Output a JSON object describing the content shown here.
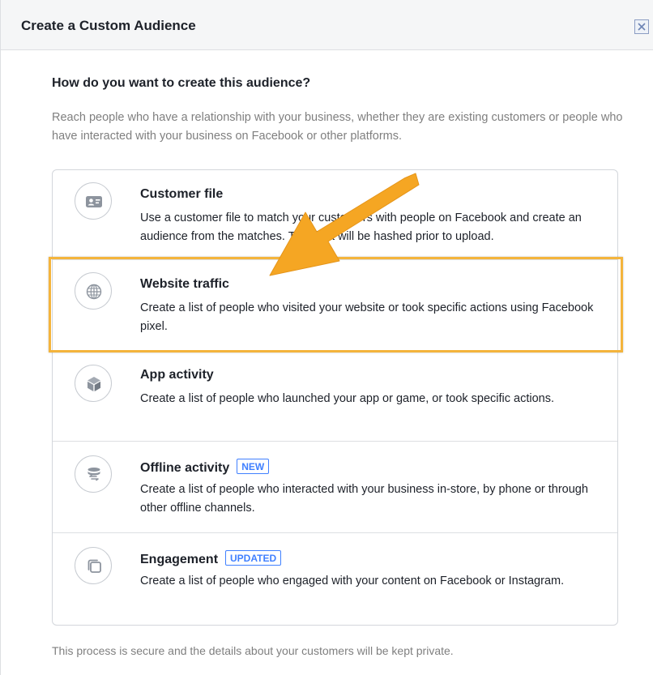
{
  "dialog": {
    "title": "Create a Custom Audience",
    "close_icon": "close-icon"
  },
  "question": "How do you want to create this audience?",
  "intro": "Reach people who have a relationship with your business, whether they are existing customers or people who have interacted with your business on Facebook or other platforms.",
  "options": [
    {
      "title": "Customer file",
      "description": "Use a customer file to match your customers with people on Facebook and create an audience from the matches. The data will be hashed prior to upload.",
      "icon": "contact-card-icon",
      "badge": ""
    },
    {
      "title": "Website traffic",
      "description": "Create a list of people who visited your website or took specific actions using Facebook pixel.",
      "icon": "globe-icon",
      "badge": "",
      "highlighted": true
    },
    {
      "title": "App activity",
      "description": "Create a list of people who launched your app or game, or took specific actions.",
      "icon": "cube-icon",
      "badge": ""
    },
    {
      "title": "Offline activity",
      "description": "Create a list of people who interacted with your business in-store, by phone or through other offline channels.",
      "icon": "database-icon",
      "badge": "NEW"
    },
    {
      "title": "Engagement",
      "description": "Create a list of people who engaged with your content on Facebook or Instagram.",
      "icon": "stacked-posts-icon",
      "badge": "UPDATED"
    }
  ],
  "footer_note": "This process is secure and the details about your customers will be kept private.",
  "colors": {
    "highlight": "#f4b43c",
    "arrow": "#f5a623",
    "badge": "#4080ff",
    "muted_text": "#7f7f7f"
  }
}
